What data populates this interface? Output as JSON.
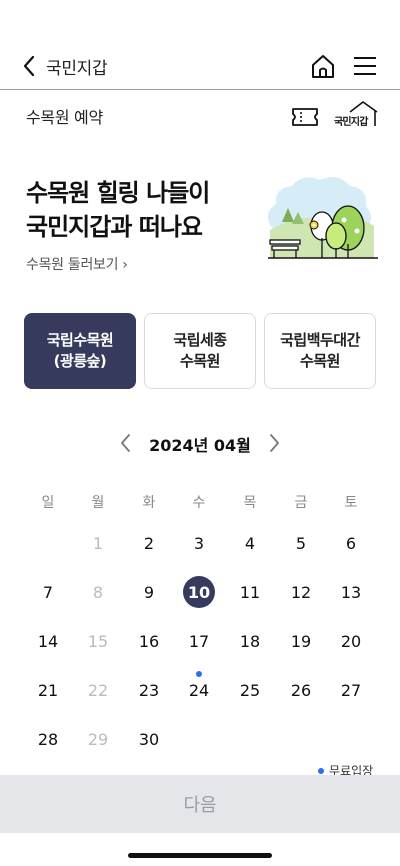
{
  "nav": {
    "title": "국민지갑",
    "back_icon": "chevron-left-icon",
    "home_icon": "home-icon",
    "menu_icon": "hamburger-menu-icon"
  },
  "sub_header": {
    "title": "수목원 예약",
    "ticket_icon": "ticket-icon",
    "logo_text": "국민지갑"
  },
  "hero": {
    "title_lines": [
      "수목원 힐링 나들이",
      "국민지갑과 떠나요"
    ],
    "link_label": "수목원 둘러보기",
    "illustration": "park-bench-trees-illustration"
  },
  "tabs": [
    {
      "lines": [
        "국립수목원",
        "(광릉숲)"
      ],
      "active": true
    },
    {
      "lines": [
        "국립세종",
        "수목원"
      ],
      "active": false
    },
    {
      "lines": [
        "국립백두대간",
        "수목원"
      ],
      "active": false
    }
  ],
  "calendar": {
    "month_label": "2024년 04월",
    "weekdays": [
      "일",
      "월",
      "화",
      "수",
      "목",
      "금",
      "토"
    ],
    "weeks": [
      [
        "",
        "1",
        "2",
        "3",
        "4",
        "5",
        "6"
      ],
      [
        "7",
        "8",
        "9",
        "10",
        "11",
        "12",
        "13"
      ],
      [
        "14",
        "15",
        "16",
        "17",
        "18",
        "19",
        "20"
      ],
      [
        "21",
        "22",
        "23",
        "24",
        "25",
        "26",
        "27"
      ],
      [
        "28",
        "29",
        "30",
        "",
        "",
        "",
        ""
      ]
    ],
    "disabled_days": [
      "1",
      "8",
      "15",
      "22",
      "29"
    ],
    "selected_day": "10",
    "free_entry_days": [
      "24"
    ],
    "legend_label": "무료입장"
  },
  "colors": {
    "primary": "#363b5e",
    "free_dot": "#2a6ff0",
    "disabled": "#bbbbbb"
  },
  "footer": {
    "next_label": "다음"
  }
}
